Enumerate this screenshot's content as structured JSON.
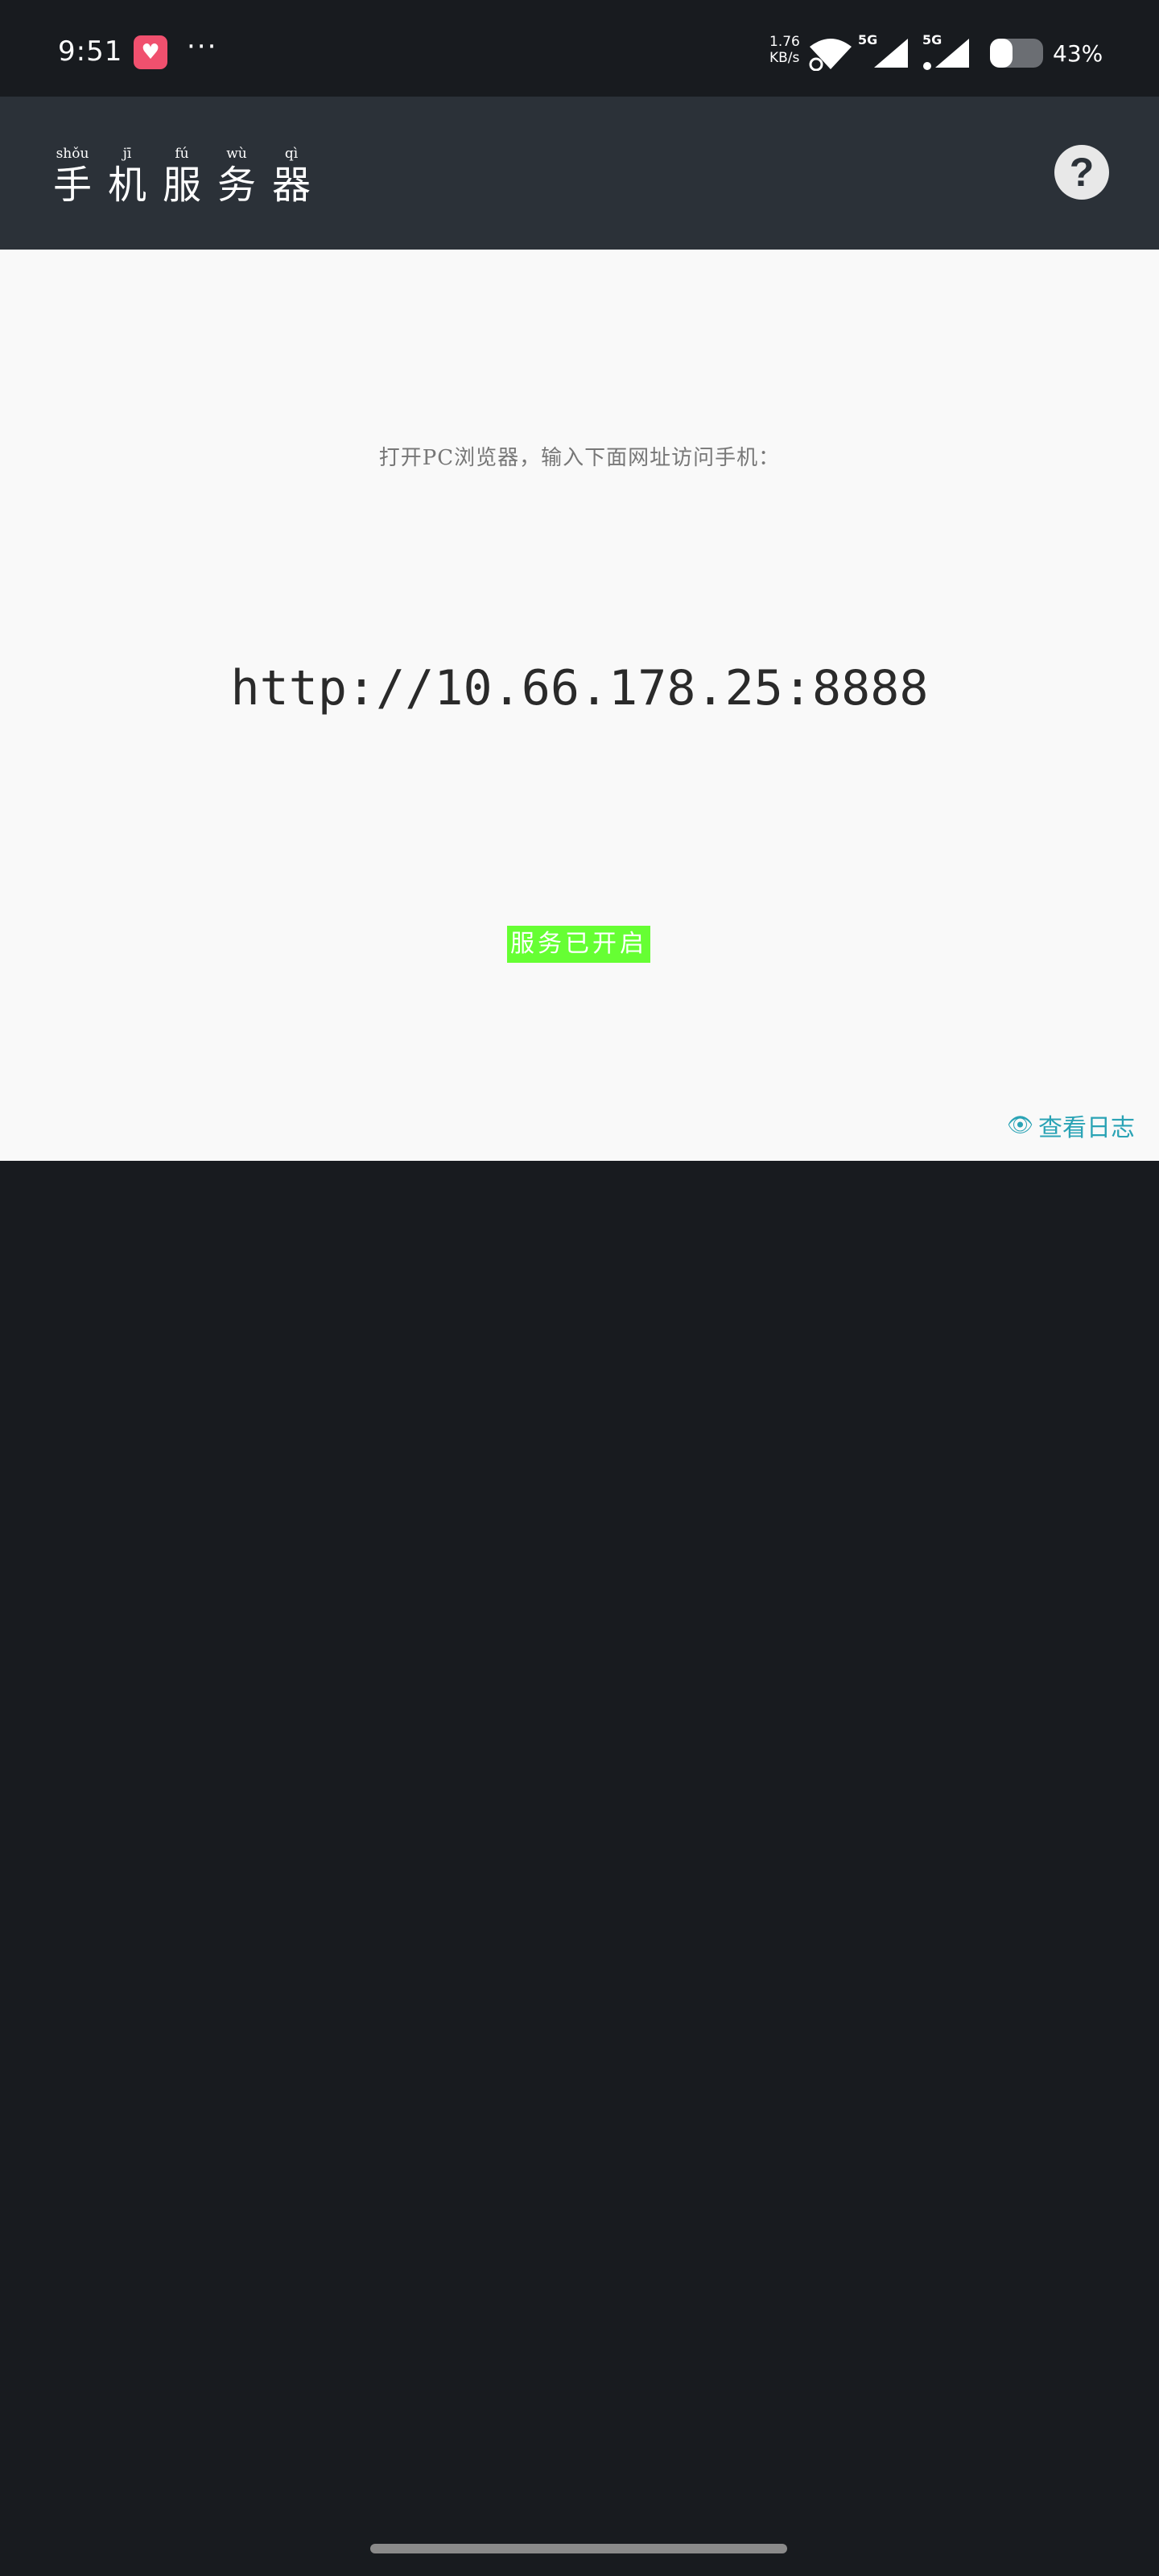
{
  "status_bar": {
    "time": "9:51",
    "app_icon": "heart-app-icon",
    "more": "···",
    "net_speed_value": "1.76",
    "net_speed_unit": "KB/s",
    "signal1_label": "5G",
    "signal2_label": "5G",
    "battery_level": 0.43,
    "battery_text": "43%"
  },
  "app_bar": {
    "title_chars": [
      {
        "pinyin": "shǒu",
        "hanzi": "手"
      },
      {
        "pinyin": "jī",
        "hanzi": "机"
      },
      {
        "pinyin": "fú",
        "hanzi": "服"
      },
      {
        "pinyin": "wù",
        "hanzi": "务"
      },
      {
        "pinyin": "qì",
        "hanzi": "器"
      }
    ],
    "help_label": "?",
    "help_icon": "question-circle-icon"
  },
  "content": {
    "instruction": "打开PC浏览器，输入下面网址访问手机：",
    "url": "http://10.66.178.25:8888",
    "status": "服务已开启",
    "view_logs": "查看日志",
    "view_logs_icon": "eye-icon"
  },
  "colors": {
    "status_bar_bg": "#181b1f",
    "app_bar_bg": "#2b3138",
    "content_bg": "#f9f9f9",
    "status_chip_bg": "#66ff33",
    "link": "#2aa3b5"
  }
}
